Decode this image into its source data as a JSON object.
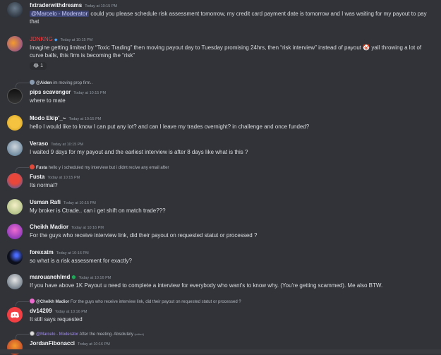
{
  "messages": [
    {
      "author": "fxtraderwithdreams",
      "timestamp": "Today at 10:15 PM",
      "mention": "@Marcelo - Moderator",
      "text": " could you please schedule risk assessment tomorrow,  my credit card payment date is tomorrow and I was waiting for my payout to pay that"
    },
    {
      "author": "JDNKNG",
      "timestamp": "Today at 10:15 PM",
      "text": "Imagine getting limited by “Toxic Trading” then moving payout day to Tuesday promising 24hrs, then “risk interview” instead of payout 🤡 yall throwing a lot of curve balls, this firm is becoming the “risk”",
      "reaction": {
        "emoji": "😂",
        "count": "1"
      }
    },
    {
      "reply": {
        "name": "@Aiden",
        "text": "im moving prop firm.."
      },
      "author": "pips scavenger",
      "timestamp": "Today at 10:15 PM",
      "text": "where to mate"
    },
    {
      "author": "Modo Ekip'_~",
      "timestamp": "Today at 10:15 PM",
      "text": "hello I would like to know I can put any lot? and can I leave my trades overnight? in challenge and once funded?"
    },
    {
      "author": "Veraso",
      "timestamp": "Today at 10:15 PM",
      "text": "I waited 9 days for my payout and the earliest interview is after 8 days like what is this ?"
    },
    {
      "reply": {
        "name": "Fusta",
        "text": "hello y i scheduled my interview but i didnt recive any email after"
      },
      "author": "Fusta",
      "timestamp": "Today at 10:15 PM",
      "text": "Its normal?"
    },
    {
      "author": "Usman Rafi",
      "timestamp": "Today at 10:15 PM",
      "text": "My broker is Ctrade..  can i get shift on match trade???"
    },
    {
      "author": "Cheikh Madior",
      "timestamp": "Today at 10:16 PM",
      "text": "For the guys who receive interview link, did their payout on requested statut or processed ?"
    },
    {
      "author": "forexatm",
      "timestamp": "Today at 10:16 PM",
      "text": "so what is a risk assessment for exactly?"
    },
    {
      "author": "marouanehlmd",
      "timestamp": "Today at 10:16 PM",
      "text": "If you have above 1K Payout u need to complete a interview for everybody who want's to know why. (You're getting scammed). Me also BTW."
    },
    {
      "reply": {
        "name": "@Cheikh Madior",
        "text": "For the guys who receive interview link, did their payout on requested statut or processed ?"
      },
      "author": "dv14209",
      "timestamp": "Today at 10:16 PM",
      "text": "It still says requested"
    },
    {
      "reply": {
        "name": "@Marcelo - Moderator",
        "text": "After the meeting. Absolutely",
        "edited": "(edited)"
      },
      "author": "JordanFibonacci",
      "timestamp": "Today at 10:16 PM",
      "text": ""
    }
  ],
  "colors": {
    "background": "#313338",
    "moderator": "#a58ef0",
    "jdnkng_name": "#f23f43",
    "discord_blurple": "#f23f43"
  },
  "icons": [
    "verified-badge-icon",
    "shield-icon",
    "discord-logo-icon"
  ]
}
